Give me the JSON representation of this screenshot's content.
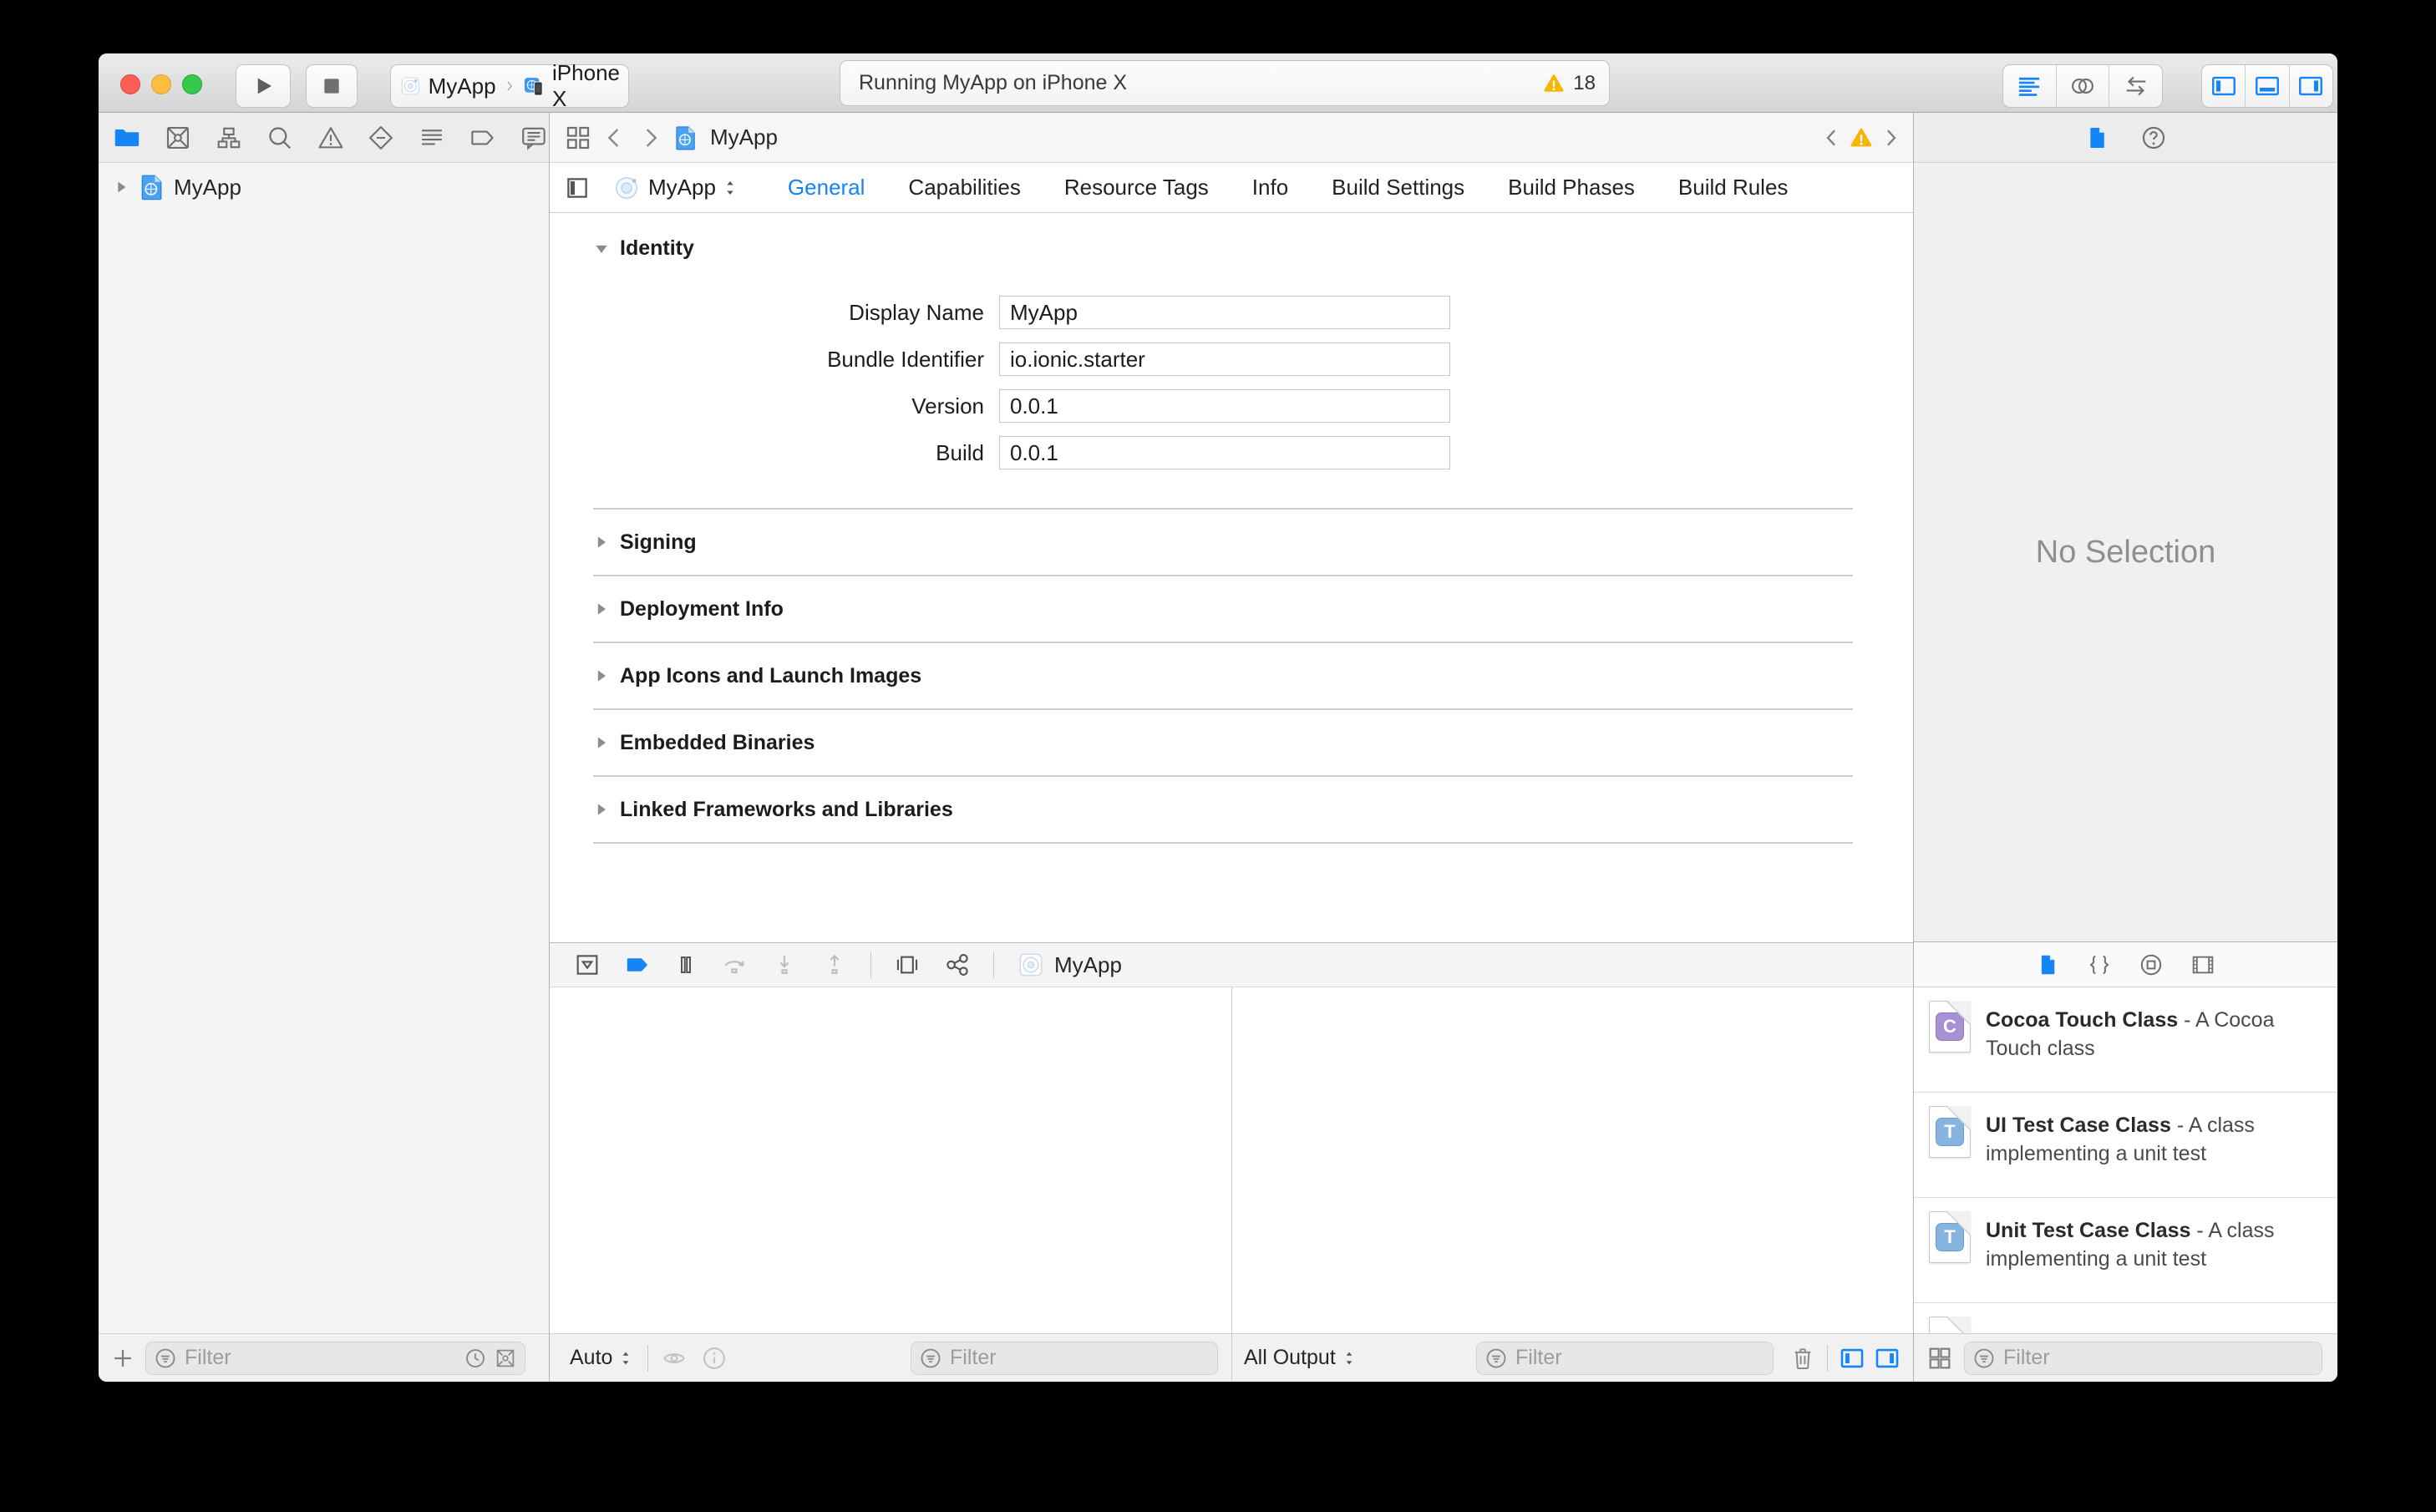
{
  "toolbar": {
    "scheme_name": "MyApp",
    "scheme_device": "iPhone X",
    "activity_status": "Running MyApp on iPhone X",
    "warning_count": "18"
  },
  "navigator": {
    "project_name": "MyApp",
    "filter_placeholder": "Filter"
  },
  "jumpbar": {
    "file_name": "MyApp"
  },
  "editor": {
    "target_name": "MyApp",
    "tabs": [
      "General",
      "Capabilities",
      "Resource Tags",
      "Info",
      "Build Settings",
      "Build Phases",
      "Build Rules"
    ],
    "selected_tab": "General",
    "identity": {
      "title": "Identity",
      "fields": [
        {
          "label": "Display Name",
          "value": "MyApp"
        },
        {
          "label": "Bundle Identifier",
          "value": "io.ionic.starter"
        },
        {
          "label": "Version",
          "value": "0.0.1"
        },
        {
          "label": "Build",
          "value": "0.0.1"
        }
      ]
    },
    "sections": [
      "Signing",
      "Deployment Info",
      "App Icons and Launch Images",
      "Embedded Binaries",
      "Linked Frameworks and Libraries"
    ]
  },
  "debug": {
    "app_name": "MyApp",
    "variables_scope": "Auto",
    "console_scope": "All Output",
    "variables_filter_placeholder": "Filter",
    "console_filter_placeholder": "Filter"
  },
  "inspector": {
    "empty_message": "No Selection"
  },
  "library": {
    "filter_placeholder": "Filter",
    "items": [
      {
        "icon_letter": "C",
        "icon_color": "#a98fd4",
        "title": "Cocoa Touch Class",
        "desc": "- A Cocoa Touch class"
      },
      {
        "icon_letter": "T",
        "icon_color": "#85b4e0",
        "title": "UI Test Case Class",
        "desc": "- A class implementing a unit test"
      },
      {
        "icon_letter": "T",
        "icon_color": "#85b4e0",
        "title": "Unit Test Case Class",
        "desc": "- A class implementing a unit test"
      }
    ]
  },
  "colors": {
    "accent": "#1584f4",
    "warning": "#f7b500"
  }
}
